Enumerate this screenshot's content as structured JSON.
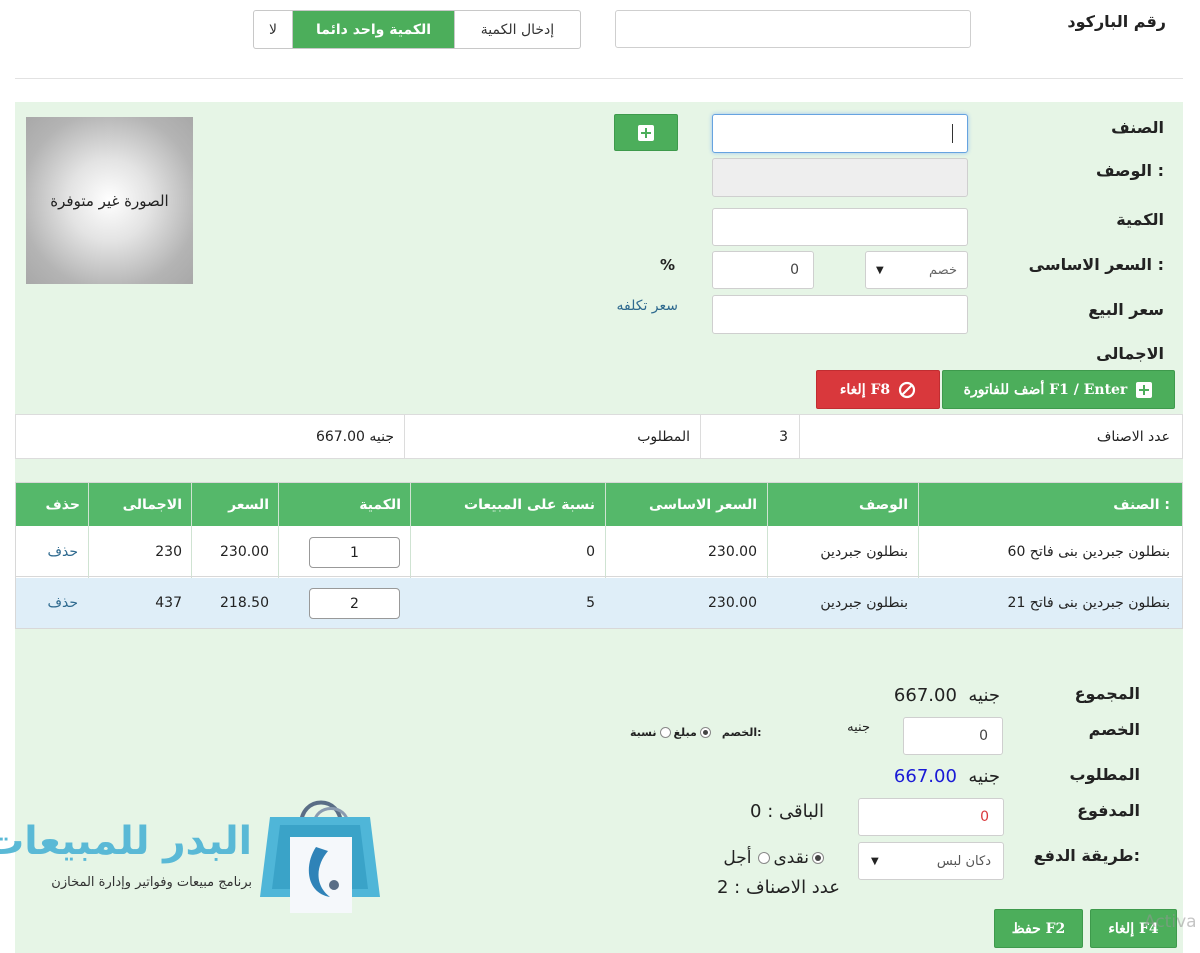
{
  "top": {
    "barcode_label": "رقم الباركود",
    "barcode_value": "",
    "qty_options": [
      "إدخال الكمية",
      "الكمية واحد دائما",
      "لا"
    ]
  },
  "item_form": {
    "item_label": "الصنف",
    "desc_label": "الوصف :",
    "qty_label": "الكمية",
    "base_price_label": "السعر الاساسى :",
    "sell_price_label": "سعر البيع",
    "total_label": "الاجمالى",
    "discount_select": "خصم",
    "discount_value": "0",
    "percent_sign": "%",
    "cost_price_link": "سعر تكلفه",
    "image_placeholder": "الصورة غير متوفرة",
    "add_button": "أضف للفاتورة F1 / Enter",
    "cancel_button": "إلغاء F8"
  },
  "summary": {
    "count_label": "عدد الاصناف",
    "count_value": "3",
    "required_label": "المطلوب",
    "required_value": "667.00 جنيه"
  },
  "table": {
    "headers": [
      "الصنف :",
      "الوصف",
      "السعر الاساسى",
      "نسبة على المبيعات",
      "الكمية",
      "السعر",
      "الاجمالى",
      "حذف"
    ],
    "rows": [
      {
        "item": "بنطلون جبردين بنى فاتح 60",
        "desc": "بنطلون جبردين",
        "base": "230.00",
        "ratio": "0",
        "qty": "1",
        "price": "230.00",
        "total": "230",
        "del": "حذف"
      },
      {
        "item": "بنطلون جبردين بنى فاتح 21",
        "desc": "بنطلون جبردين",
        "base": "230.00",
        "ratio": "5",
        "qty": "2",
        "price": "218.50",
        "total": "437",
        "del": "حذف"
      }
    ]
  },
  "totals": {
    "sum_label": "المجموع",
    "sum_value": "667.00",
    "currency": "جنيه",
    "discount_label": "الخصم",
    "discount_currency": "جنيه",
    "discount_value": "0",
    "discount_type_label": "الخصم:",
    "amount_option": "مبلغ",
    "percent_option": "نسبة",
    "required_label": "المطلوب",
    "required_value": "667.00",
    "paid_label": "المدفوع",
    "paid_value": "0",
    "remaining": "الباقى : 0",
    "payment_label": "طريقة الدفع:",
    "payment_select": "دكان لبس",
    "cash_option": "نقدى",
    "credit_option": "أجل",
    "items_count": "عدد الاصناف :  2",
    "cancel_button": "إلغاء F4",
    "save_button": "حفظ F2"
  },
  "logo": {
    "title": "البدر للمبيعات",
    "subtitle": "برنامج مبيعات وفواتير وإدارة المخازن"
  },
  "watermark": "Activa"
}
